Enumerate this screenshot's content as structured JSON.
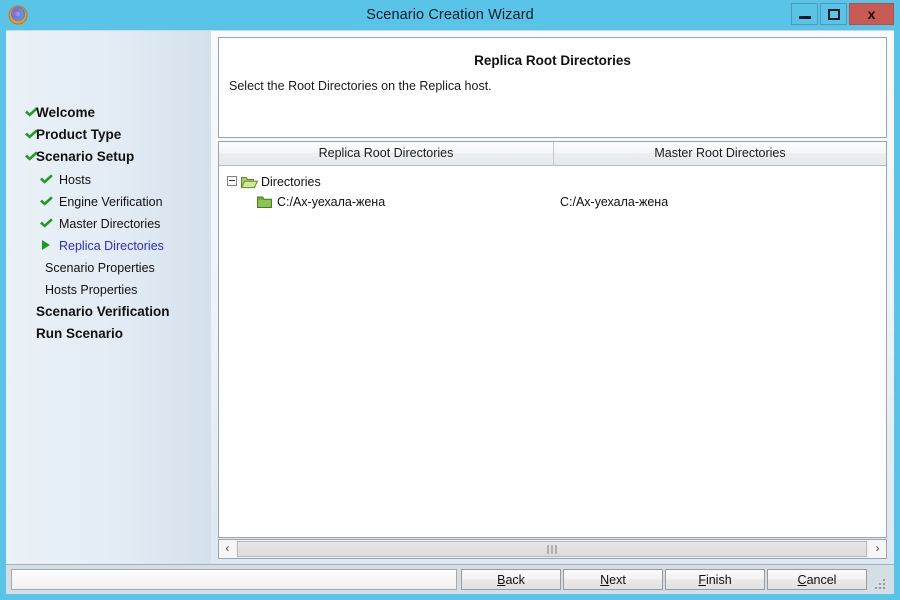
{
  "window": {
    "title": "Scenario Creation Wizard",
    "app_icon": "wizard-globe-icon",
    "minimize_label": "",
    "maximize_label": "",
    "close_label": "x",
    "frame_color": "#5ac4e8",
    "close_button_color": "#c75b53"
  },
  "sidebar": {
    "items": [
      {
        "label": "Welcome",
        "level": "top",
        "mark": "check",
        "state": "done"
      },
      {
        "label": "Product Type",
        "level": "top",
        "mark": "check",
        "state": "done"
      },
      {
        "label": "Scenario Setup",
        "level": "top",
        "mark": "check",
        "state": "done"
      },
      {
        "label": "Hosts",
        "level": "sub",
        "mark": "check",
        "state": "done"
      },
      {
        "label": "Engine Verification",
        "level": "sub",
        "mark": "check",
        "state": "done"
      },
      {
        "label": "Master Directories",
        "level": "sub",
        "mark": "check",
        "state": "done"
      },
      {
        "label": "Replica Directories",
        "level": "sub",
        "mark": "arrow",
        "state": "current"
      },
      {
        "label": "Scenario Properties",
        "level": "sub",
        "mark": "none",
        "state": "pending"
      },
      {
        "label": "Hosts Properties",
        "level": "sub",
        "mark": "none",
        "state": "pending"
      },
      {
        "label": "Scenario Verification",
        "level": "top",
        "mark": "none",
        "state": "pending"
      },
      {
        "label": "Run Scenario",
        "level": "top",
        "mark": "none",
        "state": "pending"
      }
    ],
    "check_color": "#1f9b1f",
    "current_text_color": "#2b2bd0"
  },
  "main": {
    "page_title": "Replica Root Directories",
    "page_subtitle": "Select the Root Directories on the Replica host.",
    "columns": [
      {
        "label": "Replica Root Directories"
      },
      {
        "label": "Master Root Directories"
      }
    ],
    "tree": [
      {
        "label": "Directories",
        "icon": "open-folder-icon",
        "expanded": true,
        "master": "",
        "depth": 0
      },
      {
        "label": "C:/Ах-уехала-жена",
        "icon": "folder-icon",
        "expanded": false,
        "master": "C:/Ах-уехала-жена",
        "depth": 1
      }
    ]
  },
  "scrollbar": {
    "left_arrow": "‹",
    "right_arrow": "›"
  },
  "footer": {
    "status_text": "",
    "buttons": [
      {
        "id": "back",
        "label": "Back",
        "mnemonic": "B"
      },
      {
        "id": "next",
        "label": "Next",
        "mnemonic": "N"
      },
      {
        "id": "finish",
        "label": "Finish",
        "mnemonic": "F"
      },
      {
        "id": "cancel",
        "label": "Cancel",
        "mnemonic": "C"
      }
    ]
  }
}
